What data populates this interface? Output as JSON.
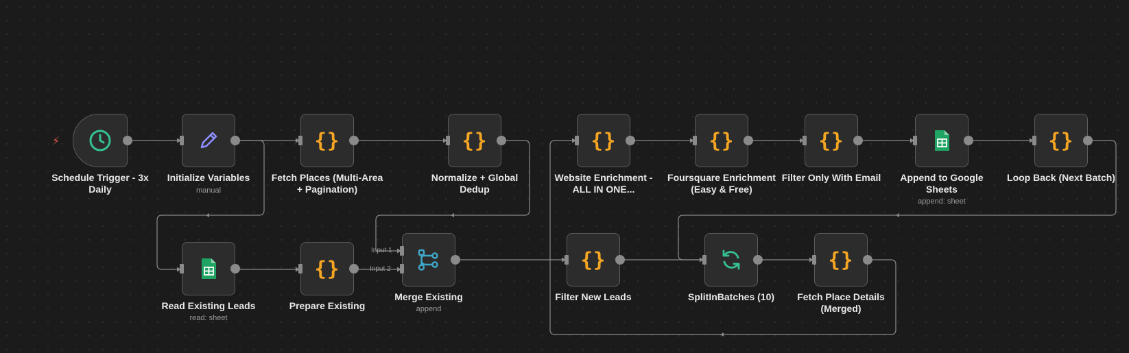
{
  "nodes": {
    "schedule": {
      "label": "Schedule Trigger - 3x Daily",
      "icon": "clock-icon"
    },
    "init": {
      "label": "Initialize Variables",
      "sub": "manual",
      "icon": "pencil-icon"
    },
    "fetch": {
      "label": "Fetch Places (Multi-Area + Pagination)",
      "icon": "code-icon"
    },
    "normalize": {
      "label": "Normalize + Global Dedup",
      "icon": "code-icon"
    },
    "website": {
      "label": "Website Enrichment - ALL IN ONE...",
      "icon": "code-icon"
    },
    "foursquare": {
      "label": "Foursquare Enrichment (Easy & Free)",
      "icon": "code-icon"
    },
    "filter_email": {
      "label": "Filter Only With Email",
      "icon": "code-icon"
    },
    "append": {
      "label": "Append to Google Sheets",
      "sub": "append: sheet",
      "icon": "google-sheets-icon"
    },
    "loop": {
      "label": "Loop Back (Next Batch)",
      "icon": "code-icon"
    },
    "read": {
      "label": "Read Existing Leads",
      "sub": "read: sheet",
      "icon": "google-sheets-icon"
    },
    "prepare": {
      "label": "Prepare Existing",
      "icon": "code-icon"
    },
    "merge": {
      "label": "Merge Existing",
      "sub": "append",
      "icon": "merge-icon",
      "input1": "Input 1",
      "input2": "Input 2"
    },
    "filter_new": {
      "label": "Filter New Leads",
      "icon": "code-icon"
    },
    "split": {
      "label": "SplitInBatches (10)",
      "icon": "refresh-icon"
    },
    "details": {
      "label": "Fetch Place Details (Merged)",
      "icon": "code-icon"
    }
  },
  "code_glyph": "{}",
  "trigger_glyph": "⚡",
  "colors": {
    "code": "#f5a623",
    "clock": "#35c291",
    "pencil": "#8c8fff",
    "sheets": "#1fa463",
    "merge": "#3fa9c9",
    "refresh": "#35c291",
    "trigger": "#e05a4f"
  }
}
